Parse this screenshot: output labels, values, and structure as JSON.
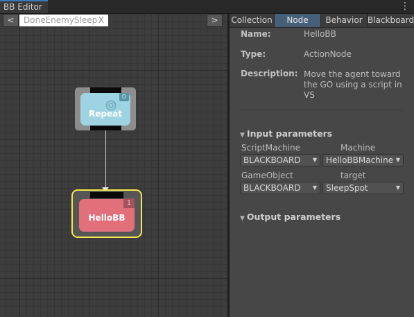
{
  "window": {
    "title": "BB Editor",
    "menu_icon": "kebab-menu-icon"
  },
  "graph": {
    "nav_back": "<",
    "nav_forward": ">",
    "breadcrumb": "DoneEnemySleep",
    "breadcrumb_close": "X",
    "nodes": [
      {
        "label": "Repeat",
        "badge": "D",
        "color": "#9ed3e1",
        "icon": "repeat-icon"
      },
      {
        "label": "HelloBB",
        "badge": "1",
        "color": "#e2707a",
        "selected": true
      }
    ]
  },
  "inspector": {
    "tabs": [
      "Collection",
      "Node",
      "Behavior",
      "Blackboard"
    ],
    "active_tab": "Node",
    "name_label": "Name:",
    "name_value": "HelloBB",
    "type_label": "Type:",
    "type_value": "ActionNode",
    "description_label": "Description:",
    "description_value": "Move the agent toward the GO using a script in VS",
    "input_section": "Input parameters",
    "input_params": [
      {
        "type": "ScriptMachine",
        "name": "Machine",
        "source": "BLACKBOARD",
        "value": "HelloBBMachine"
      },
      {
        "type": "GameObject",
        "name": "target",
        "source": "BLACKBOARD",
        "value": "SleepSpot"
      }
    ],
    "output_section": "Output parameters"
  },
  "colors": {
    "accent": "#3a79bb",
    "selection": "#f2e84c",
    "active_tab": "#46607a"
  }
}
